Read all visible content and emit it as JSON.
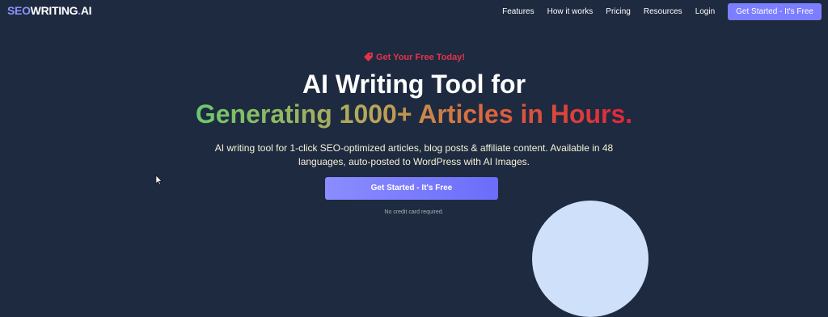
{
  "brand": {
    "logo_seo": "SEO",
    "logo_writing": "WRITING",
    "logo_dot": ".",
    "logo_ai": "AI"
  },
  "nav": {
    "links": [
      "Features",
      "How it works",
      "Pricing",
      "Resources",
      "Login"
    ],
    "cta": "Get Started - It's Free"
  },
  "hero": {
    "promo": "Get Your Free Today!",
    "title_line1": "AI Writing Tool for",
    "title_line2": "Generating 1000+ Articles in Hours.",
    "subtitle_line1": "AI writing tool for 1-click SEO-optimized articles, blog posts & affiliate content. Available in 48",
    "subtitle_line2": "languages, auto-posted to WordPress with AI Images.",
    "cta": "Get Started - It's Free",
    "note": "No credit card required."
  },
  "colors": {
    "background": "#1e2a3f",
    "accent": "#7b7fff",
    "promo": "#e5344a"
  },
  "icons": {
    "promo": "tag-icon",
    "cursor": "mouse-pointer-icon"
  }
}
